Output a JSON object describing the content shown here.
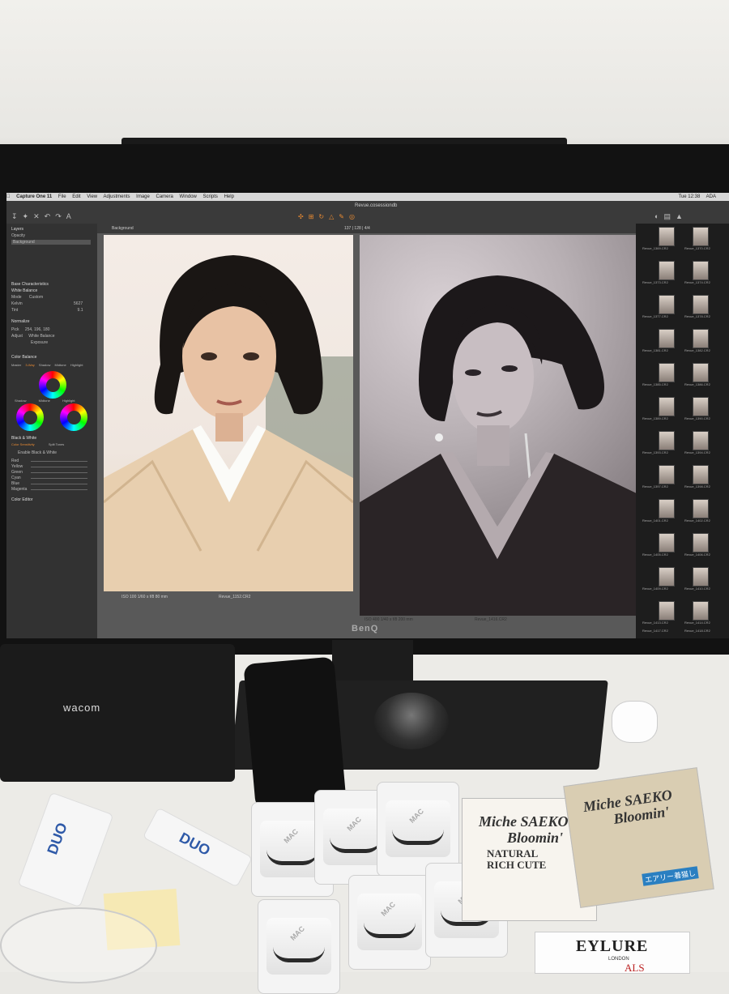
{
  "app": {
    "name": "Capture One 11",
    "menu": [
      "File",
      "Edit",
      "View",
      "Adjustments",
      "Image",
      "Camera",
      "Window",
      "Scripts",
      "Help"
    ],
    "document_title": "Revue.cosessiondb",
    "clock": "Tue 12:38",
    "user": "ADA"
  },
  "left_panel": {
    "layers_header": "Layers",
    "opacity_label": "Opacity",
    "layer_name": "Background",
    "base_characteristics": "Base Characteristics",
    "white_balance": "White Balance",
    "mode_label": "Mode",
    "mode_value": "Custom",
    "kelvin_label": "Kelvin",
    "kelvin_value": "5627",
    "tint_label": "Tint",
    "tint_value": "9.1",
    "normalize": "Normalize",
    "pick_label": "Pick",
    "pick_value": "254, 196, 180",
    "adjust_label": "Adjust",
    "wb_option": "White Balance",
    "exposure_option": "Exposure",
    "color_balance": "Color Balance",
    "cb_tabs": [
      "Master",
      "3-Way",
      "Shadow",
      "Midtone",
      "Highlight"
    ],
    "wheel_labels": [
      "Shadow",
      "Midtone",
      "Highlight"
    ],
    "black_white": "Black & White",
    "bw_tabs": [
      "Color Sensitivity",
      "Split Tones"
    ],
    "enable_bw": "Enable Black & White",
    "bw_channels": [
      "Red",
      "Yellow",
      "Green",
      "Cyan",
      "Blue",
      "Magenta"
    ],
    "color_editor": "Color Editor"
  },
  "viewer": {
    "layer_dropdown": "Background",
    "counter": "137 | 128 | 4/4",
    "left_caption": "Revue_1152.CR2",
    "right_caption": "Revue_1416.CR2",
    "left_meta": "ISO 100   1/60 s   f/8   80 mm",
    "right_meta": "ISO 400   1/40 s   f/8   200 mm"
  },
  "filmstrip": {
    "labels": [
      "Revue_1369.CR2",
      "Revue_1370.CR2",
      "Revue_1373.CR2",
      "Revue_1374.CR2",
      "Revue_1377.CR2",
      "Revue_1378.CR2",
      "Revue_1381.CR2",
      "Revue_1382.CR2",
      "Revue_1385.CR2",
      "Revue_1386.CR2",
      "Revue_1389.CR2",
      "Revue_1390.CR2",
      "Revue_1393.CR2",
      "Revue_1394.CR2",
      "Revue_1397.CR2",
      "Revue_1398.CR2",
      "Revue_1401.CR2",
      "Revue_1402.CR2",
      "Revue_1405.CR2",
      "Revue_1406.CR2",
      "Revue_1409.CR2",
      "Revue_1410.CR2",
      "Revue_1413.CR2",
      "Revue_1414.CR2",
      "Revue_1417.CR2",
      "Revue_1418.CR2"
    ]
  },
  "hardware": {
    "monitor_brand": "BenQ",
    "tablet_brand": "wacom"
  },
  "desk": {
    "lash_brand": "MAC",
    "pkg1_line1": "Miche SAEKO",
    "pkg1_line2": "Bloomin'",
    "pkg1_line3": "NATURAL",
    "pkg1_line4": "RICH CUTE",
    "pkg2_line1": "Miche SAEKO",
    "pkg2_line2": "Bloomin'",
    "glue_brand": "DUO",
    "eylure": "EYLURE",
    "eylure_sub": "LONDON",
    "eylure_bottom": "ALS",
    "pkg_ribbon": "エアリー着猫し"
  }
}
